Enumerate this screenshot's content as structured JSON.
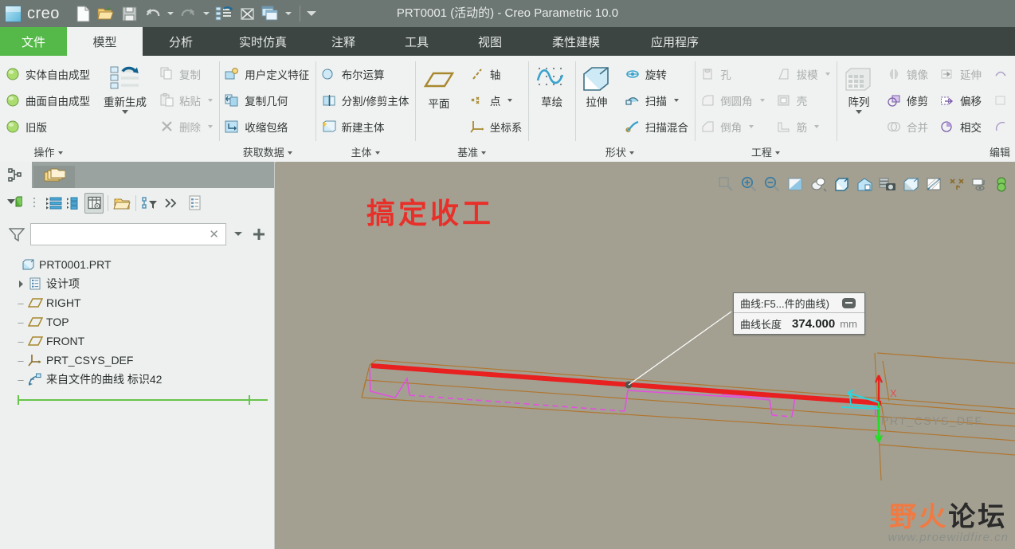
{
  "window": {
    "title": "PRT0001 (活动的) - Creo Parametric 10.0",
    "brand": "creo"
  },
  "quick_access": {
    "items": [
      {
        "name": "new-file-icon",
        "label": "新建"
      },
      {
        "name": "open-file-icon",
        "label": "打开"
      },
      {
        "name": "save-icon",
        "label": "保存"
      },
      {
        "name": "undo-icon",
        "label": "撤销"
      },
      {
        "name": "redo-icon",
        "label": "重做"
      },
      {
        "name": "regenerate-icon",
        "label": "重新生成"
      },
      {
        "name": "close-window-icon",
        "label": "关闭"
      },
      {
        "name": "switch-window-icon",
        "label": "切换窗口"
      }
    ]
  },
  "tabs": [
    {
      "label": "文件",
      "type": "file"
    },
    {
      "label": "模型",
      "type": "active"
    },
    {
      "label": "分析",
      "type": "normal"
    },
    {
      "label": "实时仿真",
      "type": "normal"
    },
    {
      "label": "注释",
      "type": "normal"
    },
    {
      "label": "工具",
      "type": "normal"
    },
    {
      "label": "视图",
      "type": "normal"
    },
    {
      "label": "柔性建模",
      "type": "normal"
    },
    {
      "label": "应用程序",
      "type": "normal"
    }
  ],
  "ribbon": {
    "groups": [
      {
        "title": "操作",
        "items": [
          {
            "label": "实体自由成型",
            "icon": "sphere-green-icon",
            "disabled": false,
            "dropdown": false
          },
          {
            "label": "曲面自由成型",
            "icon": "sphere-green-icon",
            "disabled": false,
            "dropdown": false
          },
          {
            "label": "旧版",
            "icon": "sphere-green-icon",
            "disabled": false,
            "dropdown": true
          },
          {
            "label": "重新生成",
            "icon": "regenerate-big-icon",
            "disabled": false,
            "dropdown": true
          },
          {
            "label": "复制",
            "icon": "copy-icon",
            "disabled": true,
            "dropdown": false
          },
          {
            "label": "粘贴",
            "icon": "paste-icon",
            "disabled": true,
            "dropdown": true
          },
          {
            "label": "删除",
            "icon": "delete-x-icon",
            "disabled": true,
            "dropdown": true
          }
        ]
      },
      {
        "title": "获取数据",
        "items": [
          {
            "label": "用户定义特征",
            "icon": "udf-icon",
            "disabled": false,
            "dropdown": false
          },
          {
            "label": "复制几何",
            "icon": "copy-geometry-icon",
            "disabled": false,
            "dropdown": false
          },
          {
            "label": "收缩包络",
            "icon": "shrinkwrap-icon",
            "disabled": false,
            "dropdown": false
          }
        ]
      },
      {
        "title": "主体",
        "items": [
          {
            "label": "布尔运算",
            "icon": "boolean-icon",
            "disabled": false,
            "dropdown": false
          },
          {
            "label": "分割/修剪主体",
            "icon": "split-body-icon",
            "disabled": false,
            "dropdown": false
          },
          {
            "label": "新建主体",
            "icon": "new-body-icon",
            "disabled": false,
            "dropdown": false
          }
        ]
      },
      {
        "title": "基准",
        "items": [
          {
            "label": "平面",
            "icon": "datum-plane-icon",
            "disabled": false,
            "dropdown": false
          },
          {
            "label": "轴",
            "icon": "datum-axis-icon",
            "disabled": false,
            "dropdown": false
          },
          {
            "label": "点",
            "icon": "datum-point-icon",
            "disabled": false,
            "dropdown": true
          },
          {
            "label": "坐标系",
            "icon": "datum-csys-icon",
            "disabled": false,
            "dropdown": false
          },
          {
            "label": "草绘",
            "icon": "sketch-icon",
            "disabled": false,
            "dropdown": false
          }
        ]
      },
      {
        "title": "形状",
        "items": [
          {
            "label": "拉伸",
            "icon": "extrude-icon",
            "disabled": false,
            "dropdown": false
          },
          {
            "label": "旋转",
            "icon": "revolve-icon",
            "disabled": false,
            "dropdown": false
          },
          {
            "label": "扫描",
            "icon": "sweep-icon",
            "disabled": false,
            "dropdown": true
          },
          {
            "label": "扫描混合",
            "icon": "swept-blend-icon",
            "disabled": false,
            "dropdown": false
          }
        ]
      },
      {
        "title": "工程",
        "items": [
          {
            "label": "孔",
            "icon": "hole-icon",
            "disabled": true,
            "dropdown": false
          },
          {
            "label": "倒圆角",
            "icon": "round-icon",
            "disabled": true,
            "dropdown": true
          },
          {
            "label": "倒角",
            "icon": "chamfer-icon",
            "disabled": true,
            "dropdown": true
          },
          {
            "label": "拔模",
            "icon": "draft-icon",
            "disabled": true,
            "dropdown": true
          },
          {
            "label": "壳",
            "icon": "shell-icon",
            "disabled": true,
            "dropdown": false
          },
          {
            "label": "筋",
            "icon": "rib-icon",
            "disabled": true,
            "dropdown": true
          }
        ]
      },
      {
        "title": "编辑",
        "items": [
          {
            "label": "阵列",
            "icon": "pattern-icon",
            "disabled": false,
            "dropdown": true
          },
          {
            "label": "镜像",
            "icon": "mirror-icon",
            "disabled": true,
            "dropdown": false
          },
          {
            "label": "修剪",
            "icon": "trim-icon",
            "disabled": false,
            "dropdown": false
          },
          {
            "label": "合并",
            "icon": "merge-icon",
            "disabled": true,
            "dropdown": false
          },
          {
            "label": "延伸",
            "icon": "extend-icon",
            "disabled": true,
            "dropdown": false
          },
          {
            "label": "偏移",
            "icon": "offset-icon",
            "disabled": false,
            "dropdown": false
          },
          {
            "label": "相交",
            "icon": "intersect-icon",
            "disabled": false,
            "dropdown": false
          }
        ]
      }
    ]
  },
  "left_panel": {
    "tabs": [
      {
        "name": "model-tree-tab",
        "label": "模型树"
      },
      {
        "name": "layer-tree-tab",
        "label": "层树"
      }
    ],
    "toolbar": [
      {
        "name": "tree-settings-icon",
        "label": "设置"
      },
      {
        "name": "show-icon",
        "label": "显示"
      },
      {
        "name": "tree-columns-icon",
        "label": "树列"
      },
      {
        "name": "tree-list-icon",
        "label": "列表"
      },
      {
        "name": "tree-columns-active-icon",
        "label": "树列"
      },
      {
        "name": "folder-browser-icon",
        "label": "文件夹浏览器"
      },
      {
        "name": "tree-filter-icon",
        "label": "树过滤器"
      },
      {
        "name": "more-chevron-icon",
        "label": "»"
      },
      {
        "name": "notes-icon",
        "label": "注释"
      }
    ],
    "filter": {
      "value": "",
      "placeholder": ""
    },
    "tree": [
      {
        "label": "PRT0001.PRT",
        "icon": "part-icon",
        "level": 0,
        "expandable": false
      },
      {
        "label": "设计项",
        "icon": "design-items-icon",
        "level": 1,
        "expandable": true
      },
      {
        "label": "RIGHT",
        "icon": "datum-plane-icon",
        "level": 1,
        "expandable": false
      },
      {
        "label": "TOP",
        "icon": "datum-plane-icon",
        "level": 1,
        "expandable": false
      },
      {
        "label": "FRONT",
        "icon": "datum-plane-icon",
        "level": 1,
        "expandable": false
      },
      {
        "label": "PRT_CSYS_DEF",
        "icon": "datum-csys-icon",
        "level": 1,
        "expandable": false
      },
      {
        "label": "来自文件的曲线 标识42",
        "icon": "curve-from-file-icon",
        "level": 1,
        "expandable": false
      }
    ],
    "insert_here_label": "在此插入"
  },
  "viewport": {
    "toolbar": [
      {
        "name": "zoom-fit-icon",
        "label": "重新调整"
      },
      {
        "name": "zoom-in-icon",
        "label": "放大"
      },
      {
        "name": "zoom-out-icon",
        "label": "缩小"
      },
      {
        "name": "repaint-icon",
        "label": "重画"
      },
      {
        "name": "display-style-icon",
        "label": "显示样式"
      },
      {
        "name": "saved-orientations-icon",
        "label": "已保存方向"
      },
      {
        "name": "view-manager-icon",
        "label": "视图管理器"
      },
      {
        "name": "scene-capture-icon",
        "label": "场景"
      },
      {
        "name": "perspective-icon",
        "label": "透视图"
      },
      {
        "name": "datum-display-icon",
        "label": "基准显示"
      },
      {
        "name": "annotation-display-icon",
        "label": "注释显示"
      },
      {
        "name": "spin-center-icon",
        "label": "旋转中心"
      },
      {
        "name": "layer-display-icon",
        "label": "层显示"
      }
    ],
    "annotation_text": "搞定收工",
    "csys_label": "PRT_CSYS_DEF",
    "axis_labels": {
      "x": "X"
    },
    "measurement": {
      "header": "曲线:F5...件的曲线)",
      "property_label": "曲线长度",
      "value": "374.000",
      "unit": "mm"
    },
    "watermark": {
      "cn_orange": "野火",
      "cn_black": "论坛",
      "url": "www.proewildfire.cn"
    },
    "colors": {
      "background": "#a3a092",
      "highlight_curve": "#e8201f",
      "sketch_curve": "#e44ee0",
      "surface_edge": "#b08040",
      "accent_green": "#54b948"
    }
  }
}
